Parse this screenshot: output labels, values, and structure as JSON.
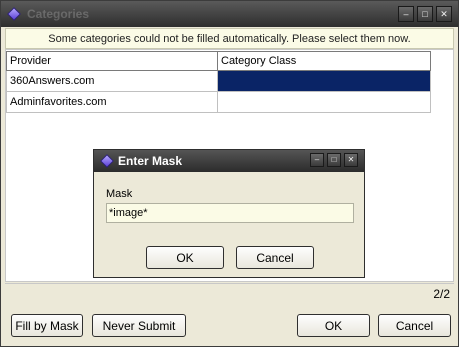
{
  "window": {
    "title": "Categories",
    "minimize": "–",
    "maximize": "□",
    "close": "✕"
  },
  "message": "Some categories could not be filled automatically. Please select them now.",
  "grid": {
    "columns": [
      "Provider",
      "Category Class"
    ],
    "rows": [
      {
        "provider": "360Answers.com",
        "category": "",
        "selected": true
      },
      {
        "provider": "Adminfavorites.com",
        "category": "",
        "selected": false
      }
    ]
  },
  "status": {
    "page": "2/2"
  },
  "buttons": {
    "fill_by_mask": "Fill by Mask",
    "never_submit": "Never Submit",
    "ok": "OK",
    "cancel": "Cancel"
  },
  "dialog": {
    "title": "Enter Mask",
    "label": "Mask",
    "value": "*image*",
    "ok": "OK",
    "cancel": "Cancel"
  },
  "colors": {
    "selection": "#0a2466",
    "titlebar": "#3a3a3a",
    "input_bg": "#fbfbe6"
  }
}
